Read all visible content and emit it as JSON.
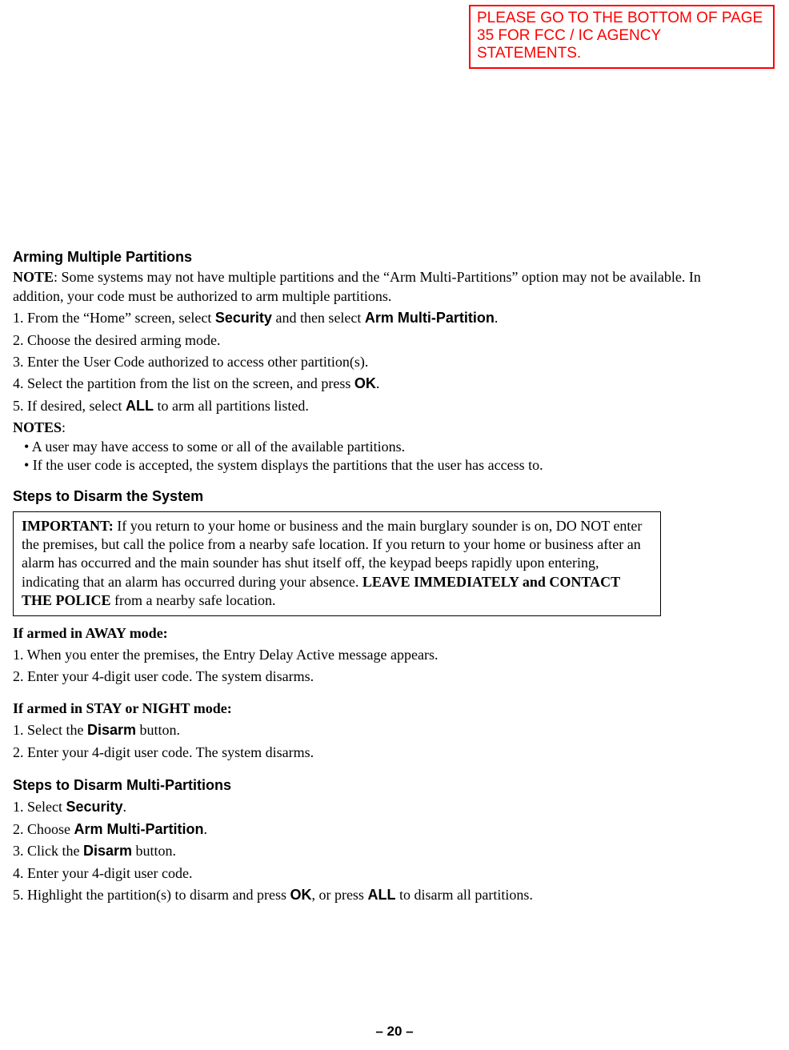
{
  "callout": "PLEASE GO TO THE BOTTOM OF PAGE 35 FOR FCC / IC AGENCY STATEMENTS.",
  "s1": {
    "title": "Arming Multiple Partitions",
    "note_label": "NOTE",
    "note_body": ": Some systems may not have multiple partitions and the “Arm Multi-Partitions” option may not be available. In addition, your code must be authorized to arm multiple partitions.",
    "step1a": "1. From the “Home” screen, select ",
    "step1b": "Security",
    "step1c": " and then select ",
    "step1d": "Arm Multi-Partition",
    "step1e": ".",
    "step2": "2. Choose the desired arming mode.",
    "step3": "3. Enter the User Code authorized to access other partition(s).",
    "step4a": "4. Select the partition from the list on the screen, and press ",
    "step4b": "OK",
    "step4c": ".",
    "step5a": "5. If desired, select ",
    "step5b": "ALL",
    "step5c": " to arm all partitions listed.",
    "notes_label": "NOTES",
    "notes_colon": ":",
    "bul1": "•  A user may have access to some or all of the available partitions.",
    "bul2": "•  If the user code is accepted, the system displays the partitions that the user has access to."
  },
  "s2": {
    "title": "Steps to Disarm the System",
    "important_label": "IMPORTANT:",
    "important_body1": " If you return to your home or business and the main burglary sounder is on, DO NOT enter the premises, but call the police from a nearby safe location. If you return to your home or business after an alarm has occurred and the main sounder has shut itself off, the keypad beeps rapidly upon entering, indicating that an alarm has occurred during your absence. ",
    "important_bold": "LEAVE IMMEDIATELY and CONTACT THE POLICE",
    "important_body2": " from a nearby safe location."
  },
  "s3": {
    "title": "If armed in AWAY mode:",
    "step1": "1.   When you enter the premises, the Entry Delay Active message appears.",
    "step2": "2.   Enter your 4-digit user code. The system disarms."
  },
  "s4": {
    "title": "If armed in STAY or NIGHT mode:",
    "step1a": "1. Select the ",
    "step1b": "Disarm",
    "step1c": " button.",
    "step2": "2. Enter your 4-digit user code. The system disarms."
  },
  "s5": {
    "title": "Steps to Disarm Multi-Partitions",
    "step1a": "1.   Select ",
    "step1b": "Security",
    "step1c": ".",
    "step2a": "2.   Choose ",
    "step2b": "Arm Multi-Partition",
    "step2c": ".",
    "step3a": "3.   Click the ",
    "step3b": "Disarm",
    "step3c": " button.",
    "step4": "4.   Enter your 4-digit user code.",
    "step5a": "5.   Highlight the partition(s) to disarm and press ",
    "step5b": "OK",
    "step5c": ", or press ",
    "step5d": "ALL",
    "step5e": " to disarm all partitions."
  },
  "page_number": "– 20 –"
}
